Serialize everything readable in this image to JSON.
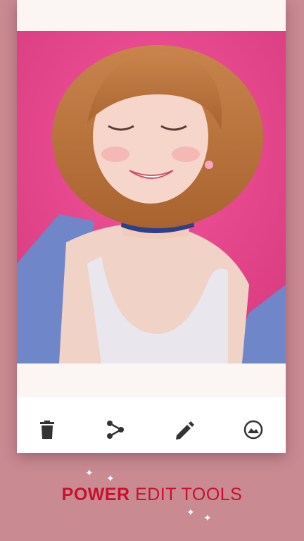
{
  "toolbar": {
    "items": [
      {
        "icon": "trash-icon"
      },
      {
        "icon": "share-icon"
      },
      {
        "icon": "edit-pencil-icon"
      },
      {
        "icon": "filter-icon"
      }
    ]
  },
  "caption": {
    "strong": "POWER",
    "light": "EDIT TOOLS"
  },
  "colors": {
    "background": "#c98a92",
    "accent": "#c8102e",
    "photo_wall": "#e8408a"
  }
}
